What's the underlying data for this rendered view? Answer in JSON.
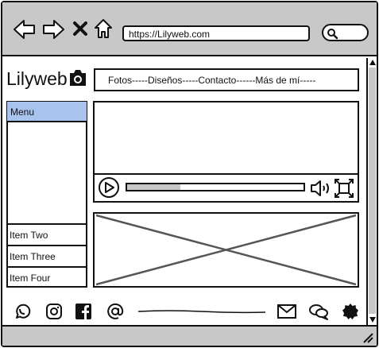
{
  "browser": {
    "url": "https://Lilyweb.com",
    "icons": [
      "back-arrow-icon",
      "forward-arrow-icon",
      "close-icon",
      "home-icon",
      "search-icon"
    ]
  },
  "site": {
    "logo_text": "Lilyweb",
    "logo_icon": "camera-icon",
    "nav_text": "Fotos-----Diseños-----Contacto------Más de mí-----"
  },
  "sidebar": {
    "menu_label": "Menu",
    "items": [
      {
        "label": "Item Two"
      },
      {
        "label": "Item Three"
      },
      {
        "label": "Item Four"
      }
    ]
  },
  "video": {
    "progress": 0.3,
    "icons": [
      "play-icon",
      "volume-icon",
      "fullscreen-icon"
    ]
  },
  "footer": {
    "icons": [
      "whatsapp-icon",
      "instagram-icon",
      "facebook-icon",
      "at-icon",
      "mail-icon",
      "chat-icon",
      "badge-icon"
    ]
  },
  "colors": {
    "chrome_gray": "#c8c8c8",
    "accent_blue": "#a8c4ee",
    "ink": "#111111"
  }
}
